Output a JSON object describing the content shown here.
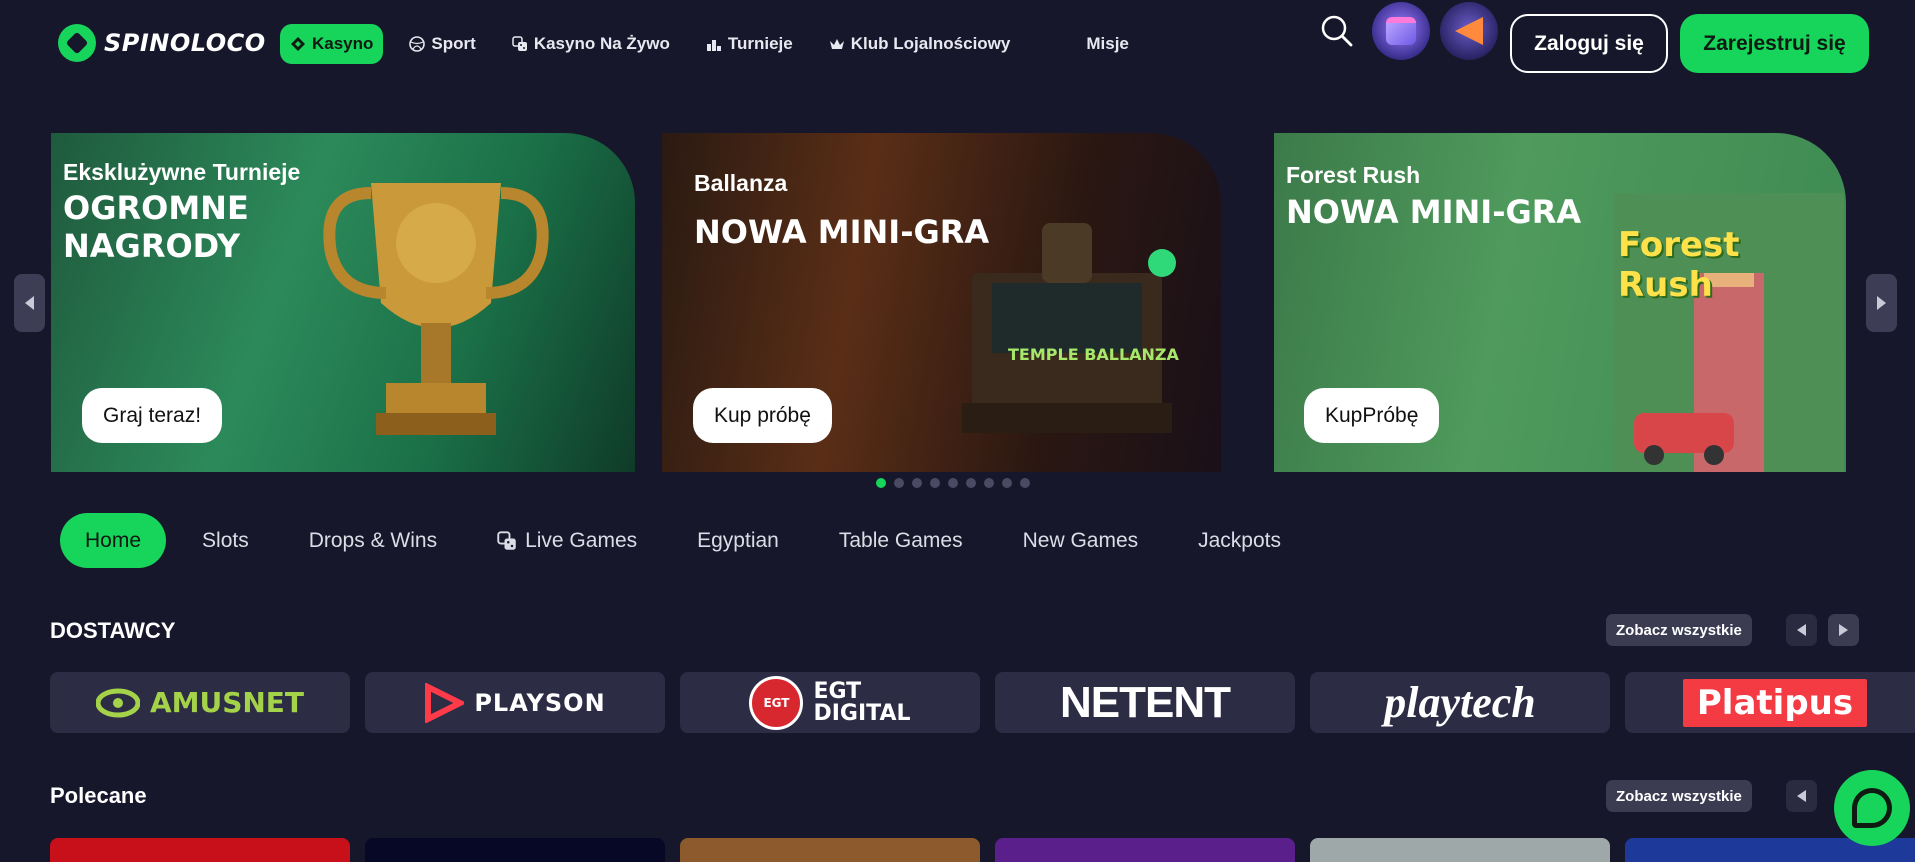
{
  "brand": {
    "name": "SPINOLOCO",
    "accent": "#17d45a",
    "background": "#17172c"
  },
  "nav": {
    "items": [
      {
        "label": "Kasyno",
        "icon": "diamond-icon",
        "active": true
      },
      {
        "label": "Sport",
        "icon": "ball-icon"
      },
      {
        "label": "Kasyno Na Żywo",
        "icon": "dice-icon"
      },
      {
        "label": "Turnieje",
        "icon": "podium-icon"
      },
      {
        "label": "Klub Lojalnościowy",
        "icon": "crown-icon"
      },
      {
        "label": "Misje"
      }
    ]
  },
  "header": {
    "search_icon": "search-icon",
    "gift_icon": "gift-icon",
    "promo_icon": "megaphone-icon",
    "login_label": "Zaloguj się",
    "register_label": "Zarejestruj się"
  },
  "banners": [
    {
      "subtitle": "Eksklużywne Turnieje",
      "title": "OGROMNE NAGRODY",
      "cta": "Graj teraz!"
    },
    {
      "subtitle": "Ballanza",
      "title": "NOWA MINI-GRA",
      "art_text": "TEMPLE BALLANZA",
      "cta": "Kup próbę"
    },
    {
      "subtitle": "Forest Rush",
      "title": "NOWA MINI-GRA",
      "art_text": "Forest Rush",
      "cta": "KupPróbę"
    }
  ],
  "carousel": {
    "dots": 9,
    "active_dot": 0
  },
  "tabs": [
    {
      "label": "Home",
      "active": true
    },
    {
      "label": "Slots"
    },
    {
      "label": "Drops & Wins"
    },
    {
      "label": "Live Games",
      "icon": "dice-icon"
    },
    {
      "label": "Egyptian"
    },
    {
      "label": "Table Games"
    },
    {
      "label": "New Games"
    },
    {
      "label": "Jackpots"
    }
  ],
  "providers_section": {
    "title": "DOSTAWCY",
    "see_all": "Zobacz wszystkie",
    "providers": [
      "AMUSNET",
      "PLAYSON",
      "EGT DIGITAL",
      "NETENT",
      "playtech",
      "Platipus"
    ],
    "egt_badge": "EGT",
    "egt_badge_sub": "DIGITAL",
    "egt_line1": "EGT",
    "egt_line2": "DIGITAL"
  },
  "featured_section": {
    "title": "Polecane",
    "see_all": "Zobacz wszystkie"
  }
}
